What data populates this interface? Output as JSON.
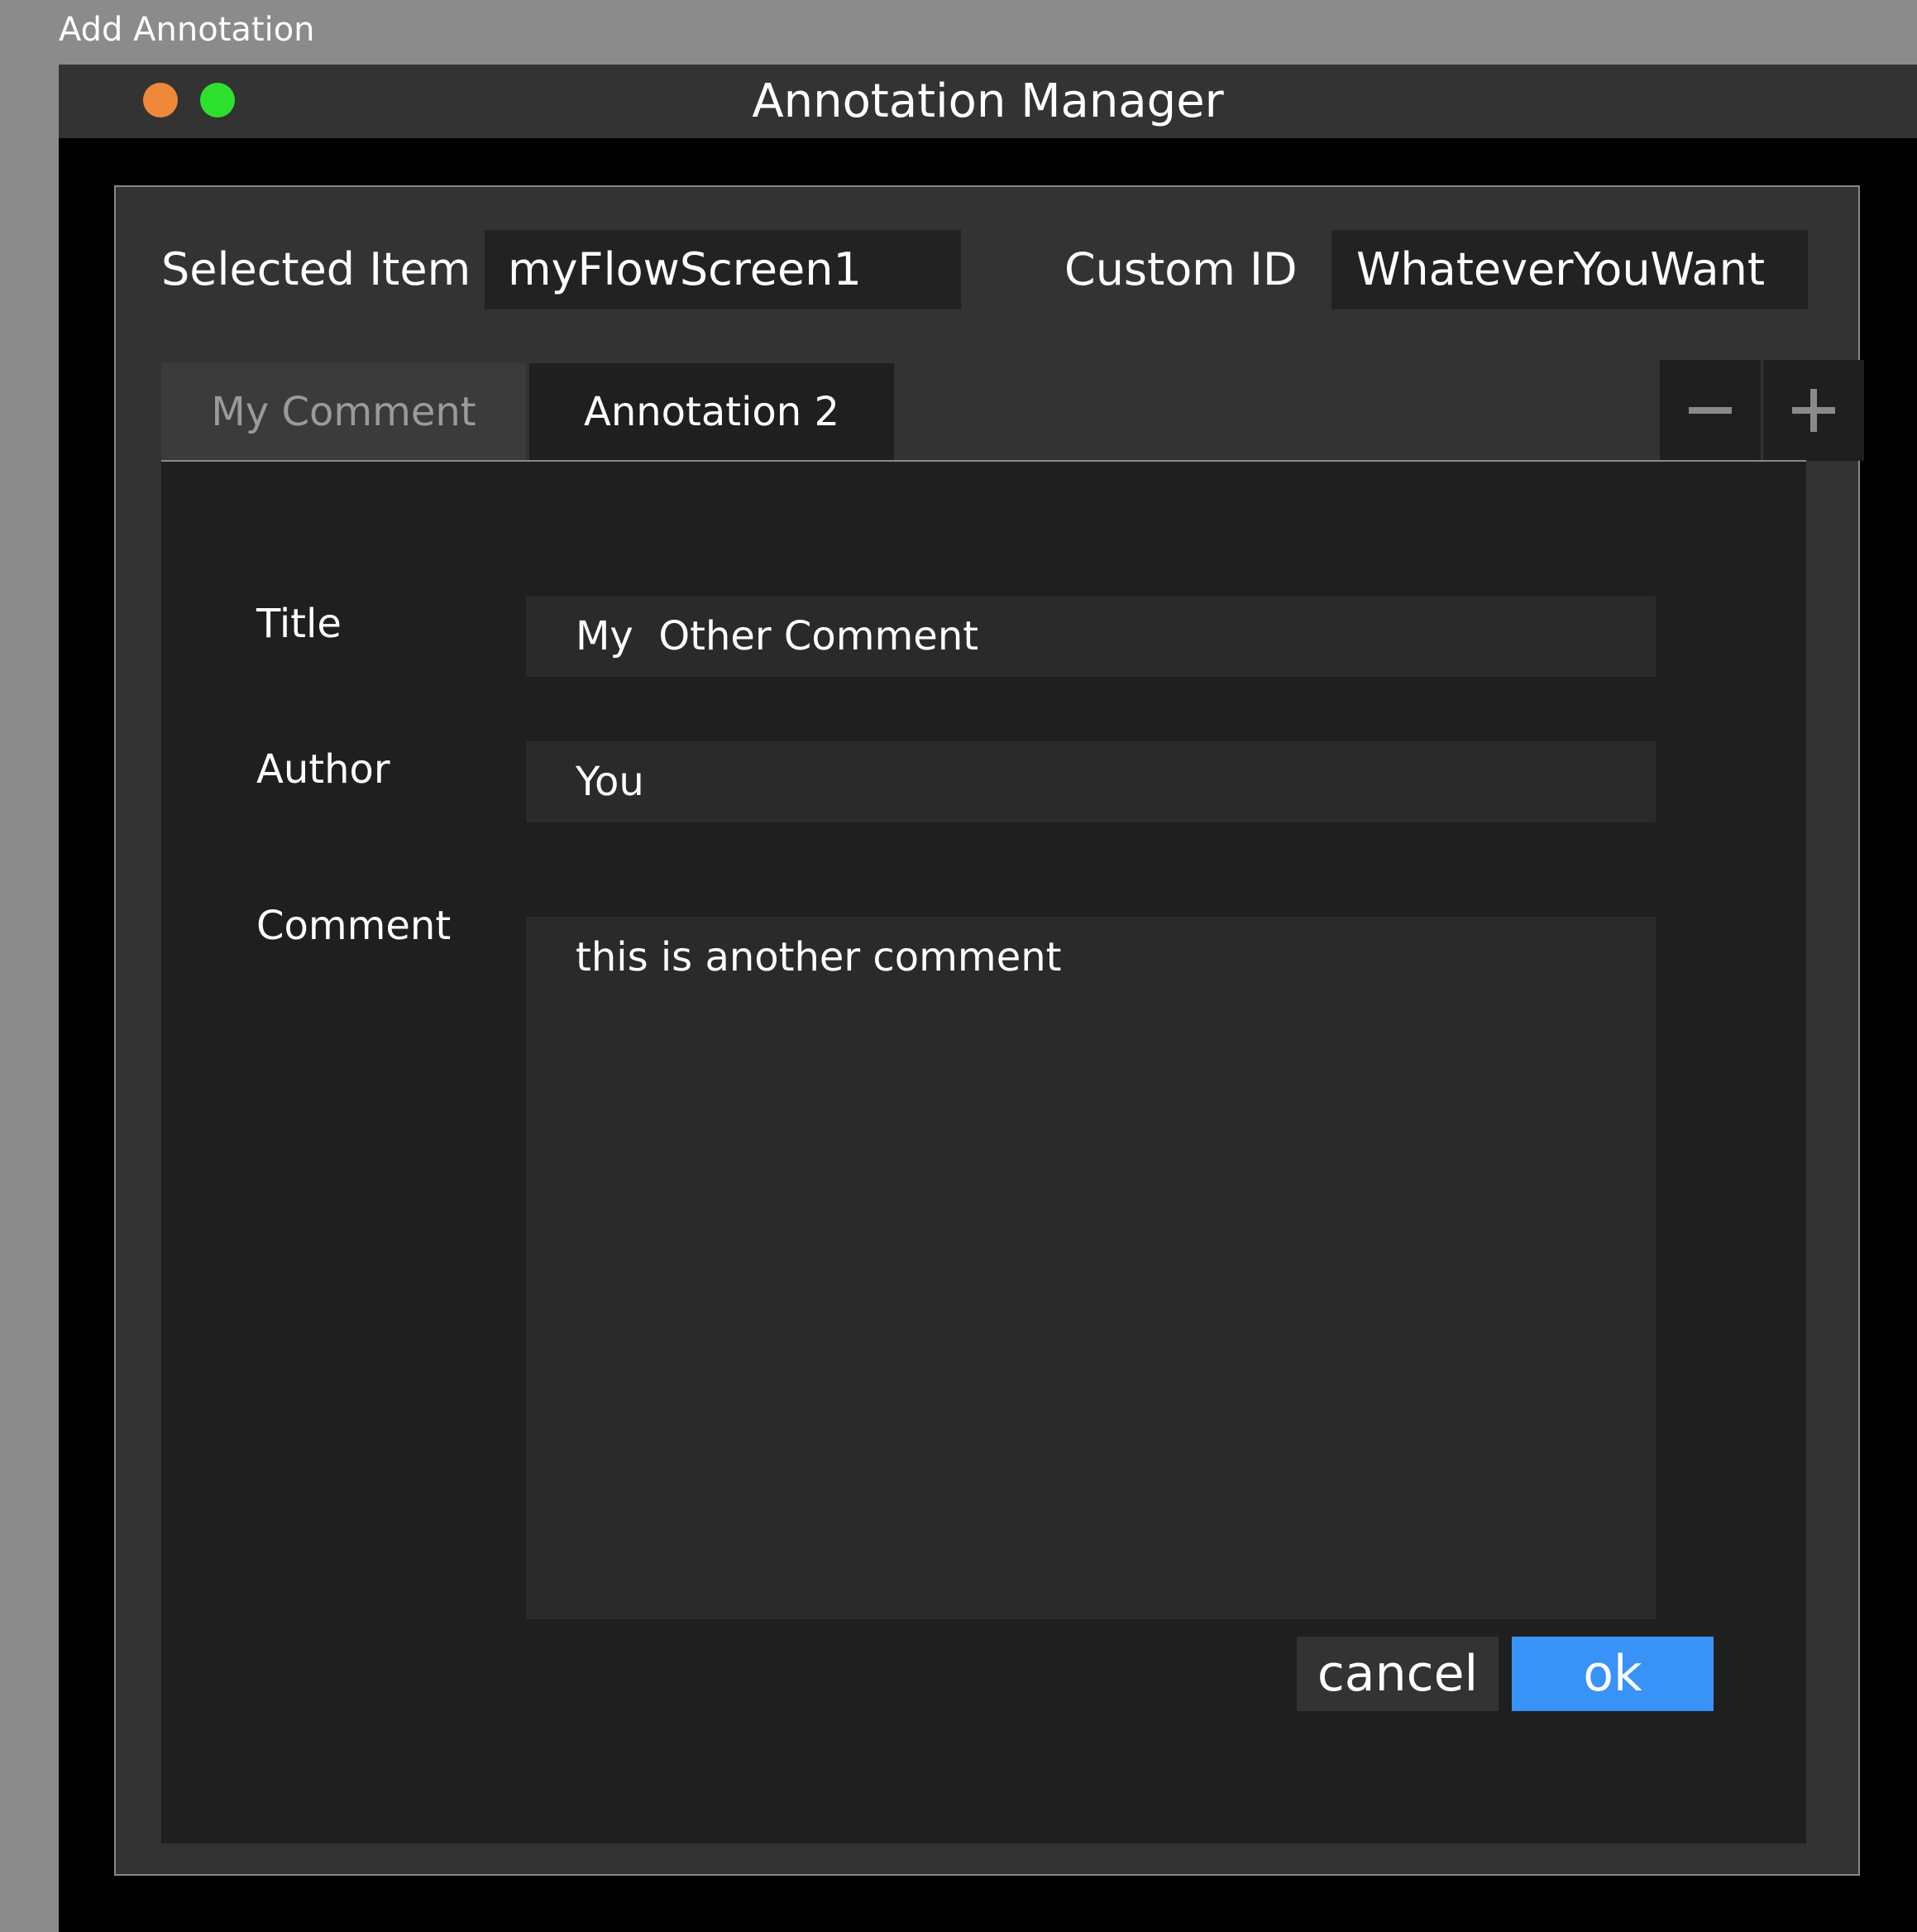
{
  "outer_window": {
    "title": "Add Annotation"
  },
  "window": {
    "title": "Annotation Manager"
  },
  "header": {
    "selected_item_label": "Selected Item",
    "selected_item_value": "myFlowScreen1",
    "custom_id_label": "Custom ID",
    "custom_id_value": "WhateverYouWant"
  },
  "tabs": [
    {
      "label": "My Comment",
      "state": "inactive"
    },
    {
      "label": "Annotation 2",
      "state": "active"
    }
  ],
  "toolbar": {
    "remove_icon": "minus-icon",
    "add_icon": "plus-icon"
  },
  "form": {
    "title_label": "Title",
    "title_value": "My  Other Comment",
    "author_label": "Author",
    "author_value": "You",
    "comment_label": "Comment",
    "comment_value": "this is another comment"
  },
  "buttons": {
    "cancel_label": "cancel",
    "ok_label": "ok"
  },
  "colors": {
    "traffic_orange": "#f0883a",
    "traffic_green": "#2ee02e",
    "ok_button": "#3892f7"
  }
}
